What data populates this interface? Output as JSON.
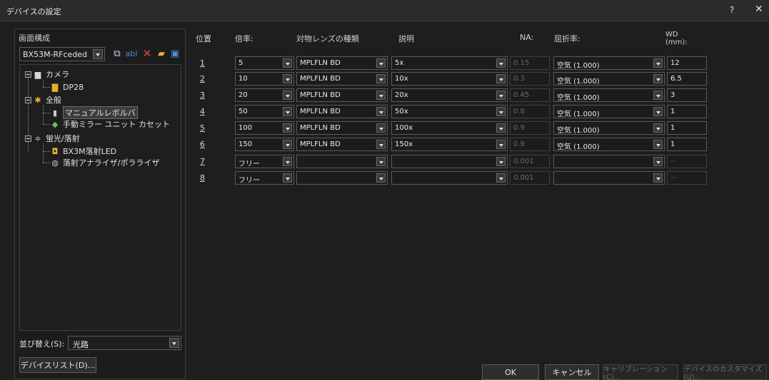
{
  "window": {
    "title": "デバイスの設定",
    "help": "?",
    "close": "✕"
  },
  "left": {
    "header": "画面構成",
    "profile": "BX53M-RFceded",
    "toolbar_rename": "abl",
    "tree": [
      {
        "label": "カメラ",
        "icon": "camera-icon"
      },
      {
        "label": "DP28",
        "icon": "camera-device-icon"
      },
      {
        "label": "全般",
        "icon": "gear-icon"
      },
      {
        "label": "マニュアルレボルバ",
        "icon": "revolver-icon"
      },
      {
        "label": "手動ミラー ユニット カセット",
        "icon": "mirror-unit-icon"
      },
      {
        "label": "蛍光/落射",
        "icon": "light-path-icon"
      },
      {
        "label": "BX3M落射LED",
        "icon": "led-icon"
      },
      {
        "label": "落射アナライザ/ポラライザ",
        "icon": "polarizer-icon"
      }
    ],
    "sort_label": "並び替え(S):",
    "sort_value": "光路",
    "device_list_button": "デバイスリスト(D)..."
  },
  "table": {
    "headers": {
      "pos": "位置",
      "mag": "倍率:",
      "lens": "対物レンズの種類",
      "desc": "説明",
      "na": "NA:",
      "ri": "屈折率:",
      "wd": "WD",
      "wd_unit": "(mm):"
    },
    "rows": [
      {
        "pos": "1",
        "mag": "5",
        "lens": "MPLFLN BD",
        "desc": "5x",
        "na": "0.15",
        "ri": "空気 (1.000)",
        "wd": "12"
      },
      {
        "pos": "2",
        "mag": "10",
        "lens": "MPLFLN BD",
        "desc": "10x",
        "na": "0.3",
        "ri": "空気 (1.000)",
        "wd": "6.5"
      },
      {
        "pos": "3",
        "mag": "20",
        "lens": "MPLFLN BD",
        "desc": "20x",
        "na": "0.45",
        "ri": "空気 (1.000)",
        "wd": "3"
      },
      {
        "pos": "4",
        "mag": "50",
        "lens": "MPLFLN BD",
        "desc": "50x",
        "na": "0.8",
        "ri": "空気 (1.000)",
        "wd": "1"
      },
      {
        "pos": "5",
        "mag": "100",
        "lens": "MPLFLN BD",
        "desc": "100x",
        "na": "0.9",
        "ri": "空気 (1.000)",
        "wd": "1"
      },
      {
        "pos": "6",
        "mag": "150",
        "lens": "MPLFLN BD",
        "desc": "150x",
        "na": "0.9",
        "ri": "空気 (1.000)",
        "wd": "1"
      },
      {
        "pos": "7",
        "mag": "フリー",
        "lens": "",
        "desc": "",
        "na": "0.001",
        "ri": "",
        "wd": "--"
      },
      {
        "pos": "8",
        "mag": "フリー",
        "lens": "",
        "desc": "",
        "na": "0.001",
        "ri": "",
        "wd": "--"
      }
    ]
  },
  "buttons": {
    "ok": "OK",
    "cancel": "キャンセル",
    "calibration": "キャリブレーション(C)...",
    "customize": "デバイスのカスタマイズ(U)..."
  }
}
